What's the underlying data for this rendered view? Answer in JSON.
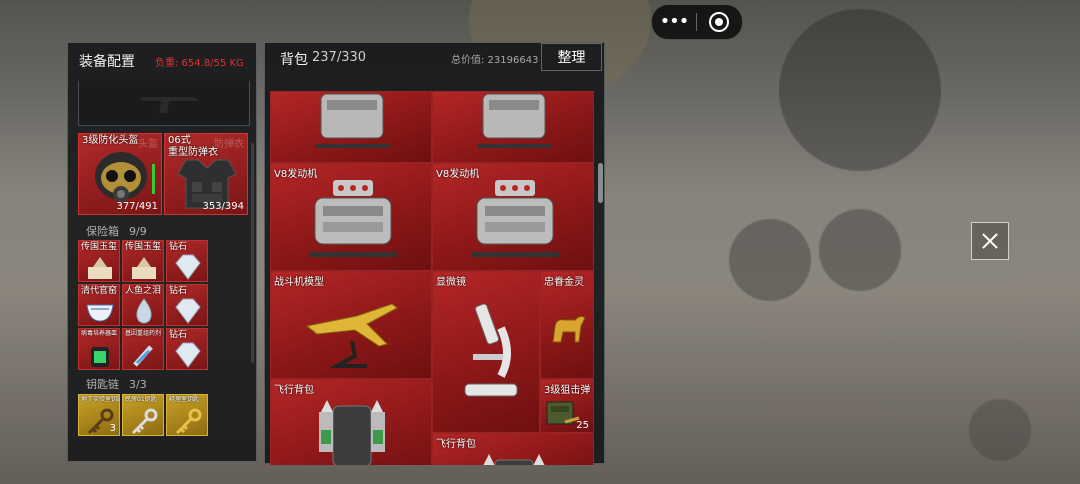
{
  "mini_capsule": {
    "more_icon": "more-dots-icon",
    "record_icon": "target-icon"
  },
  "equipment": {
    "title": "装备配置",
    "weight": "负重: 654.8/55 KG",
    "helmet": {
      "label": "3级防化头盔",
      "ghost_label": "头盔",
      "durability": "377/491"
    },
    "armor": {
      "label": "06式\n重型防弹衣",
      "ghost_label": "防弹衣",
      "durability": "353/394"
    },
    "safe_box": {
      "label": "保险箱",
      "count": "9/9",
      "items": [
        {
          "label": "传国玉玺"
        },
        {
          "label": "传国玉玺"
        },
        {
          "label": "钻石"
        },
        {
          "label": "清代官窑"
        },
        {
          "label": "人鱼之泪"
        },
        {
          "label": "钻石"
        },
        {
          "label": "病毒培养器皿"
        },
        {
          "label": "基因重组药剂"
        },
        {
          "label": "钻石"
        }
      ]
    },
    "keychain": {
      "label": "钥匙链",
      "count": "3/3",
      "items": [
        {
          "label": "地下实验室钥匙",
          "qty": "3"
        },
        {
          "label": "民房01钥匙"
        },
        {
          "label": "经理室钥匙"
        }
      ]
    }
  },
  "backpack": {
    "title": "背包",
    "count": "237/330",
    "total_value": "总价值: 23196643",
    "sort_label": "整理",
    "items": [
      {
        "label": ""
      },
      {
        "label": ""
      },
      {
        "label": "V8发动机"
      },
      {
        "label": "V8发动机"
      },
      {
        "label": "战斗机模型"
      },
      {
        "label": "显微镜"
      },
      {
        "label": "忠眷金灵"
      },
      {
        "label": "3级狙击弹",
        "qty": "25"
      },
      {
        "label": "飞行背包"
      },
      {
        "label": "飞行背包"
      }
    ]
  },
  "colors": {
    "rarity_red": "#b42626",
    "rarity_gold": "#c9a227",
    "weight_warn": "#dd3333"
  }
}
